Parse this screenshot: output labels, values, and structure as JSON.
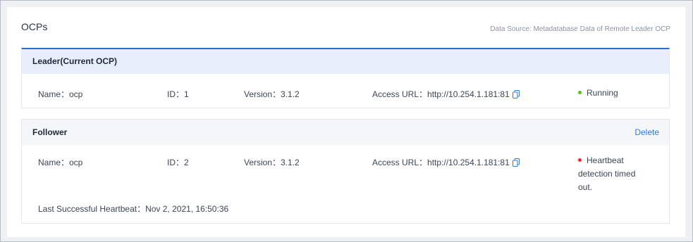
{
  "title": "OCPs",
  "data_source": "Data Source: Metadatabase Data of Remote Leader OCP",
  "leader": {
    "header": "Leader(Current OCP)",
    "name": "Name：ocp",
    "id": "ID：1",
    "version": "Version：3.1.2",
    "access_url": "Access URL：http://10.254.1.181:81",
    "status": "Running",
    "status_color": "#52c41a"
  },
  "follower": {
    "header": "Follower",
    "delete_label": "Delete",
    "name": "Name：ocp",
    "id": "ID：2",
    "version": "Version：3.1.2",
    "access_url": "Access URL：http://10.254.1.181:81",
    "status_line1": "Heartbeat",
    "status_line2": "detection timed",
    "status_line3": "out.",
    "status_color": "#f5222d",
    "last_heartbeat": "Last Successful Heartbeat：Nov 2, 2021, 16:50:36"
  },
  "icons": {
    "copy": "copy-icon"
  },
  "colors": {
    "accent": "#2f6bd8",
    "link": "#2f7ad8"
  }
}
